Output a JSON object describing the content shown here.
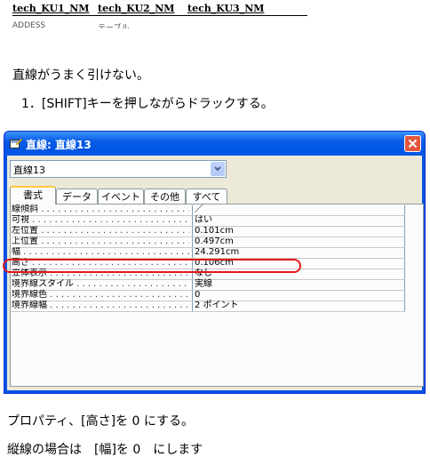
{
  "table_snippet": {
    "headers": [
      "tech_KU1_NM",
      "tech_KU2_NM",
      "tech_KU3_NM"
    ],
    "cut_cells": [
      "ADDESS",
      "テーブル"
    ]
  },
  "intro": {
    "problem": "直線がうまく引けない。",
    "step1": "1．[SHIFT]キーを押しながらドラックする。"
  },
  "dialog": {
    "title": "直線: 直線13",
    "selector_value": "直線13",
    "tabs": [
      "書式",
      "データ",
      "イベント",
      "その他",
      "すべて"
    ],
    "properties": [
      {
        "label": "線傾斜",
        "value": "／"
      },
      {
        "label": "可視",
        "value": "はい"
      },
      {
        "label": "左位置",
        "value": "0.101cm"
      },
      {
        "label": "上位置",
        "value": "0.497cm"
      },
      {
        "label": "幅",
        "value": "24.291cm"
      },
      {
        "label": "高さ",
        "value": "0.106cm"
      },
      {
        "label": "立体表示",
        "value": "なし"
      },
      {
        "label": "境界線スタイル",
        "value": "実線"
      },
      {
        "label": "境界線色",
        "value": "0"
      },
      {
        "label": "境界線幅",
        "value": "2 ポイント"
      }
    ]
  },
  "footer": {
    "note1": "プロパティ、[高さ]を 0 にする。",
    "note2": "縦線の場合は　[幅]を 0　にします"
  },
  "colors": {
    "titlebar": "#0054e3",
    "highlight": "#e21818",
    "tab_accent": "#ffc83c"
  }
}
